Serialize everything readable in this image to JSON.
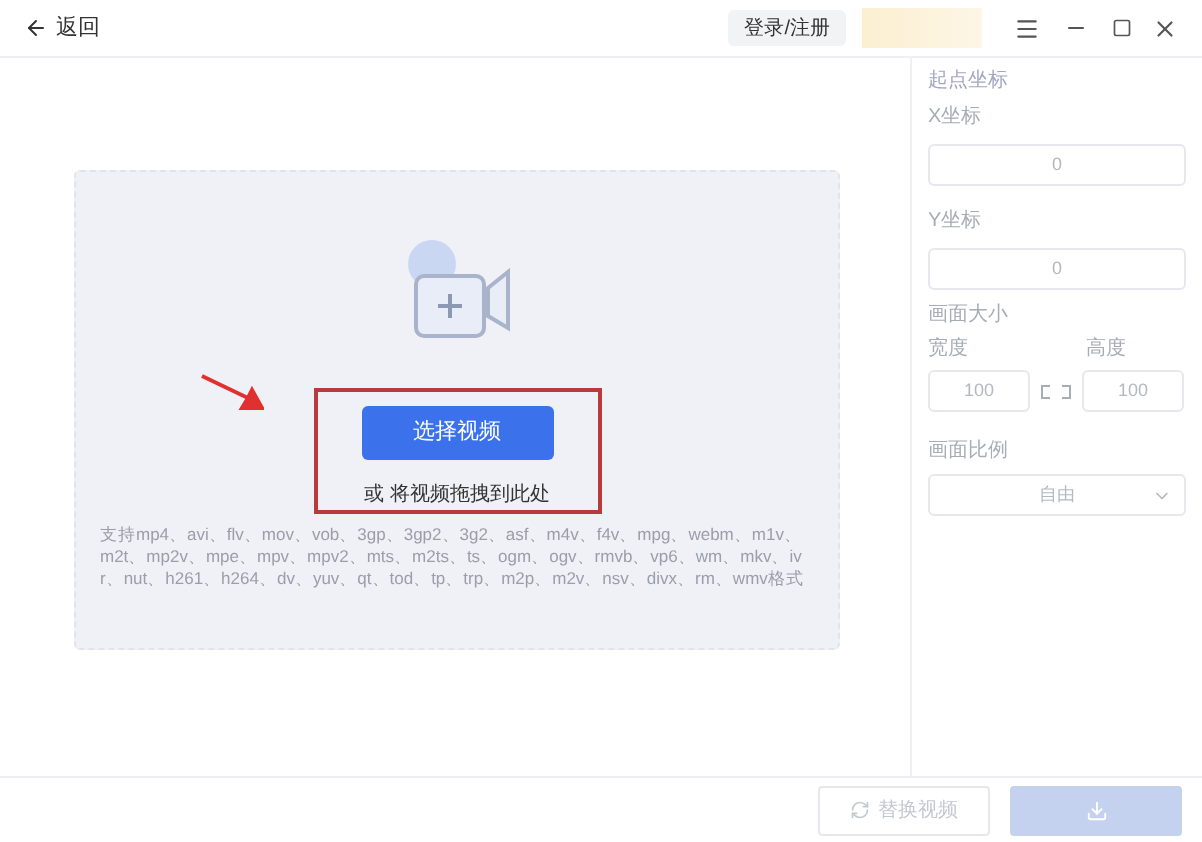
{
  "titlebar": {
    "back": "返回",
    "login_button": "登录/注册"
  },
  "upload": {
    "button": "选择视频",
    "hint": "或 将视频拖拽到此处",
    "formats": "支持mp4、avi、flv、mov、vob、3gp、3gp2、3g2、asf、m4v、f4v、mpg、webm、m1v、m2t、mp2v、mpe、mpv、mpv2、mts、m2ts、ts、ogm、ogv、rmvb、vp6、wm、mkv、ivr、nut、h261、h264、dv、yuv、qt、tod、tp、trp、m2p、m2v、nsv、divx、rm、wmv格式"
  },
  "panel": {
    "section_1": "起点坐标",
    "x_label": "X坐标",
    "x_value": "0",
    "y_label": "Y坐标",
    "y_value": "0",
    "section_2": "画面大小",
    "width_label": "宽度",
    "height_label": "高度",
    "width_value": "100",
    "height_value": "100",
    "section_3": "画面比例",
    "ratio": "自由"
  },
  "footer": {
    "replace_button": {
      "label": "替换视频",
      "disabled": true
    },
    "export_button": {
      "disabled": true
    }
  }
}
